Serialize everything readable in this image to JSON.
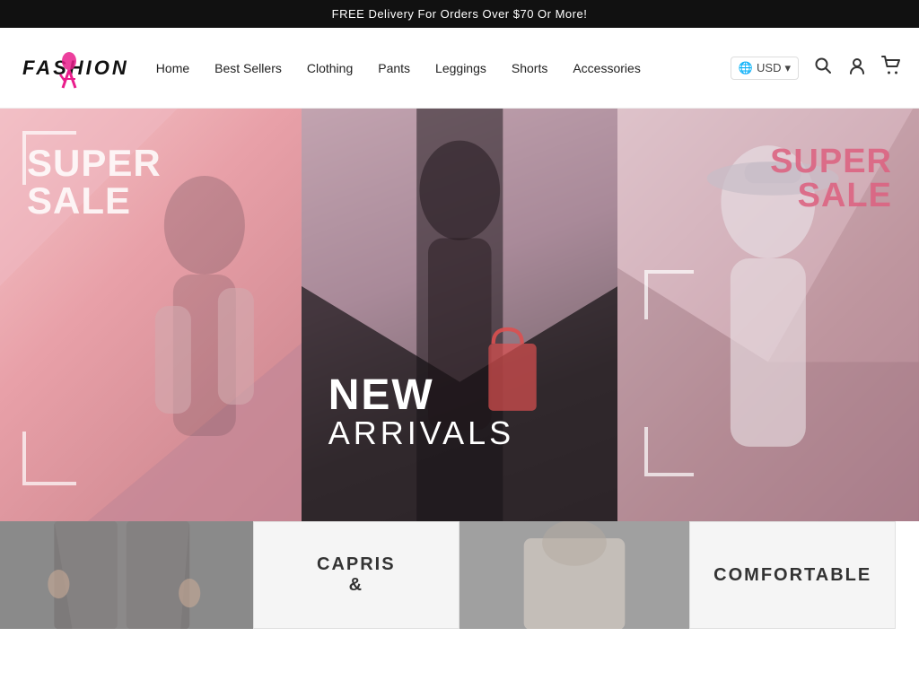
{
  "announcement": {
    "text": "FREE Delivery For Orders Over $70 Or More!"
  },
  "header": {
    "logo_text": "FASHION",
    "currency": "USD",
    "nav_items": [
      {
        "id": "home",
        "label": "Home"
      },
      {
        "id": "best-sellers",
        "label": "Best Sellers"
      },
      {
        "id": "clothing",
        "label": "Clothing"
      },
      {
        "id": "pants",
        "label": "Pants"
      },
      {
        "id": "leggings",
        "label": "Leggings"
      },
      {
        "id": "shorts",
        "label": "Shorts"
      },
      {
        "id": "accessories",
        "label": "Accessories"
      }
    ]
  },
  "hero": {
    "panel_left": {
      "line1": "SUPER",
      "line2": "SALE"
    },
    "panel_center": {
      "line1": "NEW",
      "line2": "ARRIVALS"
    },
    "panel_right": {
      "line1": "SUPER",
      "line2": "SALE"
    }
  },
  "bottom_categories": {
    "left": {
      "line1": "CAPRIS",
      "line2": "&"
    },
    "right": {
      "line1": "COMFORTABLE"
    }
  },
  "icons": {
    "globe": "🌐",
    "search": "🔍",
    "user": "👤",
    "cart": "🛒",
    "chevron_down": "▾"
  }
}
